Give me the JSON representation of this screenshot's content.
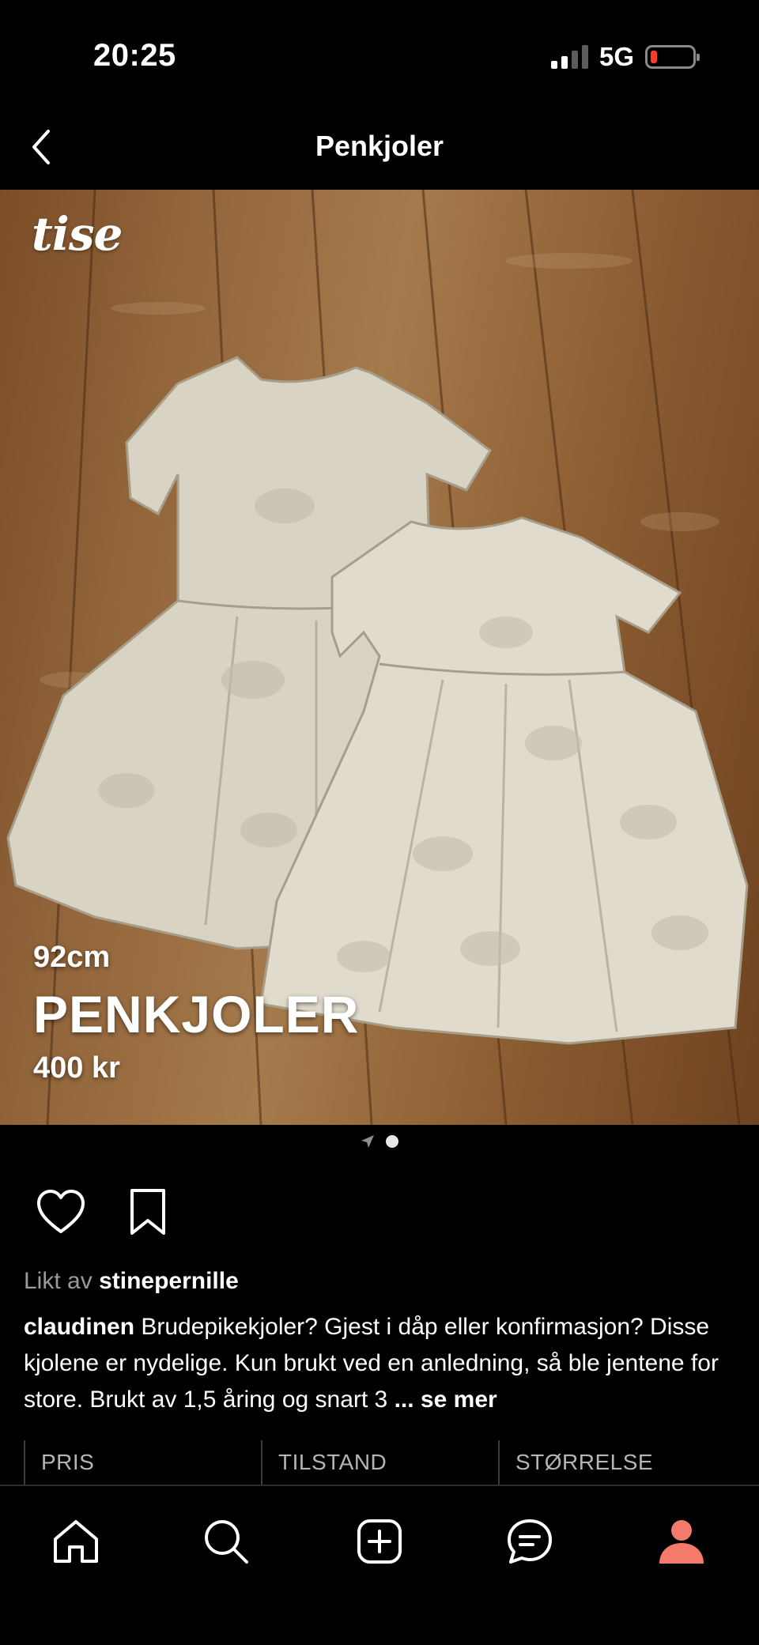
{
  "status_bar": {
    "time": "20:25",
    "network": "5G"
  },
  "header": {
    "title": "Penkjoler"
  },
  "photo": {
    "watermark": "tise",
    "size": "92cm",
    "title": "PENKJOLER",
    "price": "400 kr"
  },
  "likes": {
    "prefix": "Likt av",
    "user": "stinepernille"
  },
  "caption": {
    "user": "claudinen",
    "text": "Brudepikekjoler? Gjest i dåp eller konfirmasjon? Disse kjolene er nydelige. Kun brukt ved en anledning, så ble jentene for store. Brukt av 1,5 åring og snart 3",
    "more": "... se mer"
  },
  "info_columns": [
    "PRIS",
    "TILSTAND",
    "STØRRELSE"
  ],
  "icons": {
    "back": "chevron-left-icon",
    "like": "heart-icon",
    "save": "bookmark-icon",
    "home": "home-icon",
    "search": "search-icon",
    "add": "plus-square-icon",
    "messages": "chat-icon",
    "profile": "person-icon"
  },
  "colors": {
    "profile_accent": "#f47a6b",
    "battery_low": "#ff3b30"
  }
}
